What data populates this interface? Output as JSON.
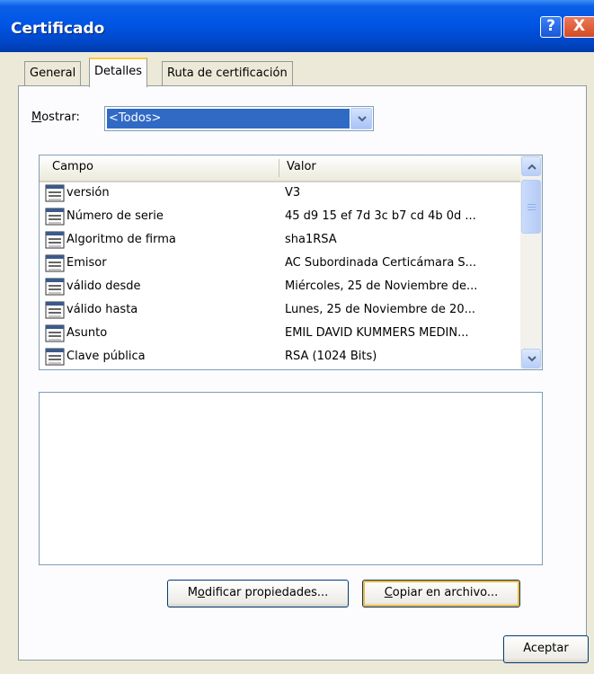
{
  "window": {
    "title": "Certificado",
    "help_label": "?",
    "close_label": "X"
  },
  "tabs": [
    {
      "label": "General",
      "active": false
    },
    {
      "label": "Detalles",
      "active": true
    },
    {
      "label": "Ruta de certificación",
      "active": false
    }
  ],
  "filter": {
    "label_prefix": "M",
    "label_rest": "ostrar:",
    "selected": "<Todos>"
  },
  "list": {
    "columns": {
      "field": "Campo",
      "value": "Valor"
    },
    "rows": [
      {
        "field": "versión",
        "value": "V3"
      },
      {
        "field": "Número de serie",
        "value": "45 d9 15 ef 7d 3c b7 cd 4b 0d ..."
      },
      {
        "field": "Algoritmo de firma",
        "value": "sha1RSA"
      },
      {
        "field": "Emisor",
        "value": "AC Subordinada Certicámara S..."
      },
      {
        "field": "válido desde",
        "value": "Miércoles, 25 de Noviembre de..."
      },
      {
        "field": "válido hasta",
        "value": "Lunes, 25 de Noviembre de 20..."
      },
      {
        "field": "Asunto",
        "value": "EMIL DAVID KUMMERS MEDIN..."
      },
      {
        "field": "Clave pública",
        "value": "RSA (1024 Bits)"
      }
    ],
    "row_icon": "certificate-field-icon"
  },
  "buttons": {
    "modificar": {
      "pre": "M",
      "accel": "o",
      "post": "dificar propiedades..."
    },
    "copiar": {
      "accel": "C",
      "post": "opiar en archivo..."
    },
    "aceptar": "Aceptar"
  },
  "colors": {
    "title_bar": "#0055e5",
    "selection": "#316ac5",
    "dialog_bg": "#ece9d8",
    "active_tab_accent": "#ffc83c"
  }
}
